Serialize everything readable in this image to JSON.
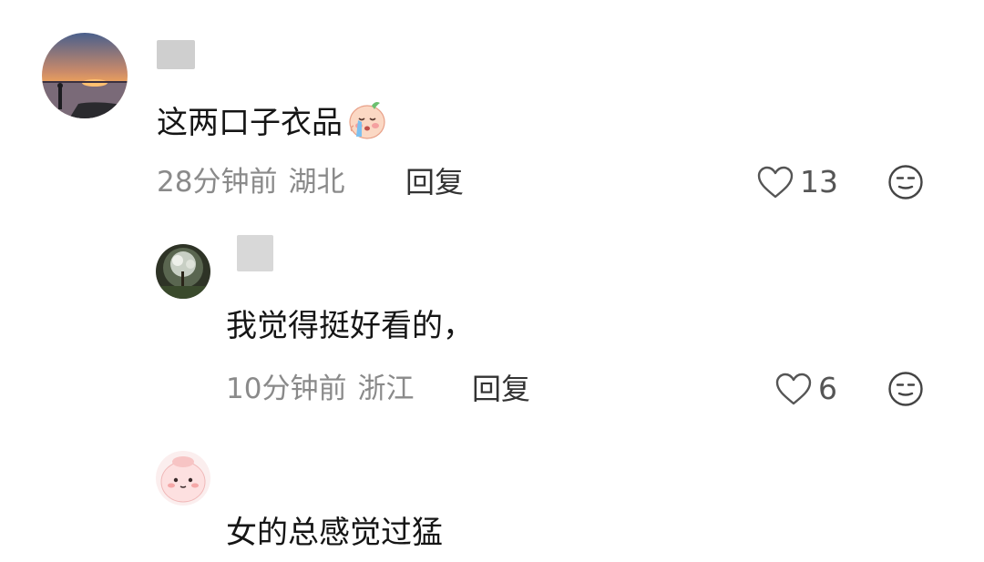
{
  "comments": [
    {
      "content": "这两口子衣品",
      "emoji_icon": "crying-peach-emoji-icon",
      "time": "28分钟前",
      "location": "湖北",
      "reply_label": "回复",
      "like_count": "13",
      "avatar_icon": "sunset-lake-avatar"
    },
    {
      "content": "我觉得挺好看的，",
      "time": "10分钟前",
      "location": "浙江",
      "reply_label": "回复",
      "like_count": "6",
      "avatar_icon": "tree-night-avatar"
    },
    {
      "content": "女的总感觉过猛",
      "avatar_icon": "pink-bun-avatar"
    }
  ],
  "icons": {
    "like": "heart-outline-icon",
    "react": "neutral-face-icon"
  },
  "colors": {
    "meta_text": "#8a8a8a",
    "reply_text": "#333333",
    "icon_stroke": "#444444",
    "username_blur": "#d8d8d8"
  }
}
